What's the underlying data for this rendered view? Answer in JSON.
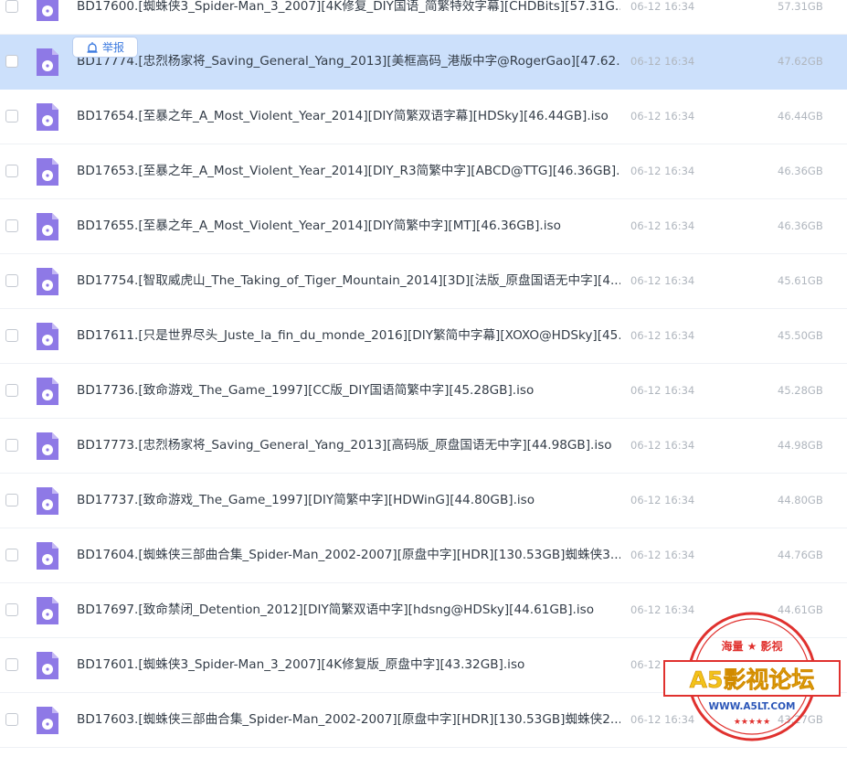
{
  "report_button": {
    "label": "举报"
  },
  "files": [
    {
      "name": "BD17600.[蜘蛛侠3_Spider-Man_3_2007][4K修复_DIY国语_简繁特效字幕][CHDBits][57.31G...",
      "time": "06-12 16:34",
      "size": "57.31GB",
      "selected": false
    },
    {
      "name": "BD17774.[忠烈杨家将_Saving_General_Yang_2013][美框高码_港版中字@RogerGao][47.62...",
      "time": "06-12 16:34",
      "size": "47.62GB",
      "selected": true
    },
    {
      "name": "BD17654.[至暴之年_A_Most_Violent_Year_2014][DIY简繁双语字幕][HDSky][46.44GB].iso",
      "time": "06-12 16:34",
      "size": "46.44GB",
      "selected": false
    },
    {
      "name": "BD17653.[至暴之年_A_Most_Violent_Year_2014][DIY_R3简繁中字][ABCD@TTG][46.36GB]...",
      "time": "06-12 16:34",
      "size": "46.36GB",
      "selected": false
    },
    {
      "name": "BD17655.[至暴之年_A_Most_Violent_Year_2014][DIY简繁中字][MT][46.36GB].iso",
      "time": "06-12 16:34",
      "size": "46.36GB",
      "selected": false
    },
    {
      "name": "BD17754.[智取威虎山_The_Taking_of_Tiger_Mountain_2014][3D][法版_原盘国语无中字][4...",
      "time": "06-12 16:34",
      "size": "45.61GB",
      "selected": false
    },
    {
      "name": "BD17611.[只是世界尽头_Juste_la_fin_du_monde_2016][DIY繁简中字幕][XOXO@HDSky][45....",
      "time": "06-12 16:34",
      "size": "45.50GB",
      "selected": false
    },
    {
      "name": "BD17736.[致命游戏_The_Game_1997][CC版_DIY国语简繁中字][45.28GB].iso",
      "time": "06-12 16:34",
      "size": "45.28GB",
      "selected": false
    },
    {
      "name": "BD17773.[忠烈杨家将_Saving_General_Yang_2013][高码版_原盘国语无中字][44.98GB].iso",
      "time": "06-12 16:34",
      "size": "44.98GB",
      "selected": false
    },
    {
      "name": "BD17737.[致命游戏_The_Game_1997][DIY简繁中字][HDWinG][44.80GB].iso",
      "time": "06-12 16:34",
      "size": "44.80GB",
      "selected": false
    },
    {
      "name": "BD17604.[蜘蛛侠三部曲合集_Spider-Man_2002-2007][原盘中字][HDR][130.53GB]蜘蛛侠3...",
      "time": "06-12 16:34",
      "size": "44.76GB",
      "selected": false
    },
    {
      "name": "BD17697.[致命禁闭_Detention_2012][DIY简繁双语中字][hdsng@HDSky][44.61GB].iso",
      "time": "06-12 16:34",
      "size": "44.61GB",
      "selected": false
    },
    {
      "name": "BD17601.[蜘蛛侠3_Spider-Man_3_2007][4K修复版_原盘中字][43.32GB].iso",
      "time": "06-12 16:34",
      "size": "43.32GB",
      "selected": false
    },
    {
      "name": "BD17603.[蜘蛛侠三部曲合集_Spider-Man_2002-2007][原盘中字][HDR][130.53GB]蜘蛛侠2...",
      "time": "06-12 16:34",
      "size": "43.27GB",
      "selected": false
    }
  ],
  "watermark": {
    "top_text": "海量 ★ 影视",
    "main_text": "A5影视论坛",
    "url": "WWW.A5LT.COM"
  },
  "colors": {
    "selected_row": "#cce0fb",
    "file_icon": "#8e79e6",
    "stamp_red": "#e0312e"
  }
}
